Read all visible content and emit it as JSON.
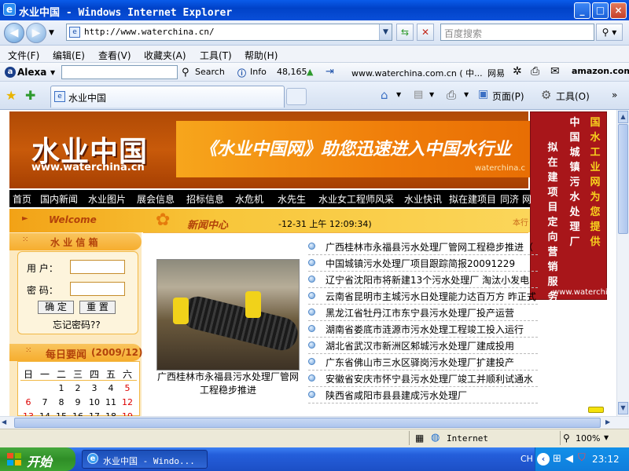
{
  "window": {
    "title": "水业中国 - Windows Internet Explorer",
    "buttons": [
      "_",
      "□",
      "×"
    ]
  },
  "address": {
    "url": "http://www.waterchina.cn/",
    "search_placeholder": "百度搜索"
  },
  "menu": [
    "文件(F)",
    "编辑(E)",
    "查看(V)",
    "收藏夹(A)",
    "工具(T)",
    "帮助(H)"
  ],
  "alexa": {
    "brand": "Alexa",
    "search": "Search",
    "info": "Info",
    "rank": "48,165",
    "site": "www.waterchina.com.cn ( 中... ",
    "netease": "网易",
    "amazon": "amazon.com"
  },
  "tabs": {
    "active": "水业中国",
    "tools": [
      "页面(P)",
      "工具(O)"
    ]
  },
  "site": {
    "logo_cn": "水业中国",
    "logo_en": "www.waterchina.cn",
    "banner_slogan": "《水业中国网》助您迅速进入中国水行业",
    "banner_url": "waterchina.c",
    "vertical_ad": [
      "国水工业网为您提供",
      "中国城镇污水处理厂",
      "拟在建项目定向营销服务"
    ],
    "vertical_ad_url": "www.waterchina.cn",
    "nav": [
      "首页",
      "国内新闻",
      "水业图片",
      "展会信息",
      "招标信息",
      "水危机",
      "水先生",
      "水业女工程师风采",
      "水业快讯",
      "拟在建项目",
      "同济",
      "网"
    ],
    "welcome": "Welcome",
    "mailbox_title": "水 业 信 箱",
    "user_label": "用  户：",
    "pass_label": "密  码：",
    "btn_ok": "确 定",
    "btn_reset": "重 置",
    "forgot": "忘记密码??",
    "daily_title": "每日要闻",
    "daily_month": "(2009/12)",
    "calendar_head": [
      "日",
      "一",
      "二",
      "三",
      "四",
      "五",
      "六"
    ],
    "calendar_rows": [
      [
        "",
        "",
        "1",
        "2",
        "3",
        "4",
        "5"
      ],
      [
        "6",
        "7",
        "8",
        "9",
        "10",
        "11",
        "12"
      ],
      [
        "13",
        "14",
        "15",
        "16",
        "17",
        "18",
        "19"
      ]
    ],
    "news_center": "新闻中心",
    "datetime": "-12-31 上午 12:09:34)",
    "news_right_tag": "本行",
    "photo_caption": "广西桂林市永福县污水处理厂管网工程稳步推进",
    "news": [
      "广西桂林市永福县污水处理厂管网工程稳步推进（",
      "中国城镇污水处理厂项目跟踪简报20091229",
      "辽宁省沈阳市将新建13个污水处理厂  淘汰小发电",
      "云南省昆明市主城污水日处理能力达百万方  昨正式",
      "黑龙江省牡丹江市东宁县污水处理厂投产运营",
      "湖南省娄底市涟源市污水处理工程竣工投入运行",
      "湖北省武汉市新洲区邾城污水处理厂建成投用",
      "广东省佛山市三水区驿岗污水处理厂扩建投产",
      "安徽省安庆市怀宁县污水处理厂竣工并顺利试通水（图）",
      "陕西省咸阳市县县建成污水处理厂"
    ]
  },
  "status": {
    "zone": "Internet",
    "zoom": "100%"
  },
  "taskbar": {
    "start": "开始",
    "task": "水业中国 - Windo...",
    "lang": "CH",
    "clock": "23:12"
  },
  "colors": {
    "xp_blue": "#0a5bea",
    "banner_orange": "#c85a0a",
    "ad_red": "#a8161a",
    "start_green": "#3ba231"
  }
}
